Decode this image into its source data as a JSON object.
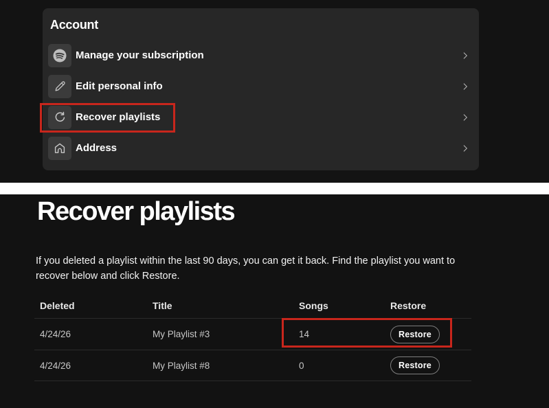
{
  "colors": {
    "page_bg_top": "#131313",
    "page_bg_bottom": "#121212",
    "panel_bg": "#272727",
    "icon_bg": "#3b3b3b",
    "divider": "#2b2b2b",
    "annotation_red": "#c8261c",
    "text_white": "#ffffff"
  },
  "account_panel": {
    "title": "Account",
    "items": [
      {
        "label": "Manage your subscription",
        "icon": "spotify-icon"
      },
      {
        "label": "Edit personal info",
        "icon": "pencil-icon"
      },
      {
        "label": "Recover playlists",
        "icon": "refresh-icon",
        "highlighted": true
      },
      {
        "label": "Address",
        "icon": "home-icon"
      }
    ]
  },
  "recover_section": {
    "title": "Recover playlists",
    "description": "If you deleted a playlist within the last 90 days, you can get it back. Find the playlist you want to recover below and click Restore.",
    "table": {
      "headers": [
        "Deleted",
        "Title",
        "Songs",
        "Restore"
      ],
      "rows": [
        {
          "deleted": "4/24/26",
          "title": "My Playlist #3",
          "songs": "14",
          "action": "Restore",
          "highlighted": true
        },
        {
          "deleted": "4/24/26",
          "title": "My Playlist #8",
          "songs": "0",
          "action": "Restore",
          "highlighted": false
        }
      ]
    }
  }
}
